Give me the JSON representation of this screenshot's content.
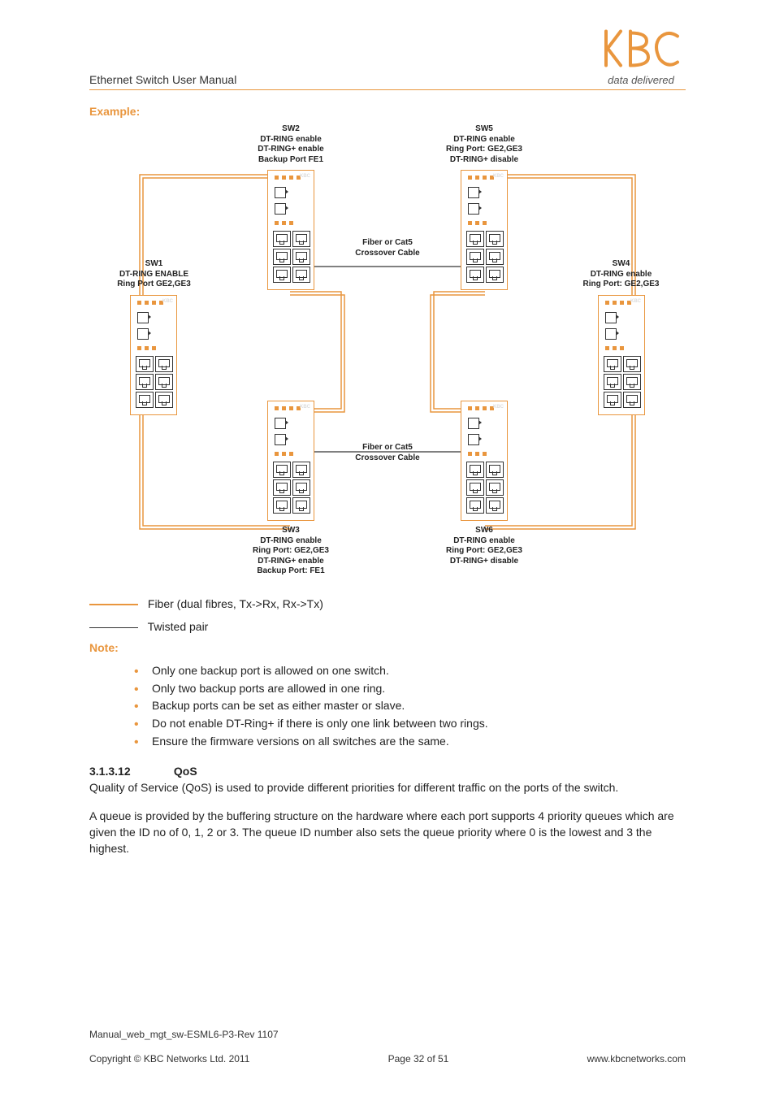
{
  "brand": {
    "tagline": "data delivered"
  },
  "header": {
    "title": "Ethernet Switch User Manual"
  },
  "example_heading": "Example:",
  "diagram": {
    "sw1": "SW1\nDT-RING ENABLE\nRing Port GE2,GE3",
    "sw2": "SW2\nDT-RING enable\nDT-RING+ enable\nBackup Port FE1",
    "sw3": "SW3\nDT-RING enable\nRing Port: GE2,GE3\nDT-RING+ enable\nBackup Port: FE1",
    "sw4": "SW4\nDT-RING enable\nRing Port: GE2,GE3",
    "sw5": "SW5\nDT-RING enable\nRing Port: GE2,GE3\nDT-RING+ disable",
    "sw6": "SW6\nDT-RING enable\nRing Port: GE2,GE3\nDT-RING+ disable",
    "cable_top": "Fiber or Cat5\nCrossover Cable",
    "cable_bottom": "Fiber or Cat5\nCrossover Cable"
  },
  "legend": {
    "fiber": "Fiber (dual fibres, Tx->Rx, Rx->Tx)",
    "twisted": "Twisted pair"
  },
  "note_heading": "Note:",
  "notes": [
    "Only one backup port is allowed on one switch.",
    "Only two backup ports are allowed in one ring.",
    "Backup ports can be set as either master or slave.",
    "Do not enable DT-Ring+ if there is only one link between two rings.",
    "Ensure the firmware versions on all switches are the same."
  ],
  "section": {
    "number": "3.1.3.12",
    "title": "QoS",
    "p1": "Quality of Service (QoS) is used to provide different priorities for different traffic on the ports of the switch.",
    "p2": "A queue is provided by the buffering structure on the hardware where each port supports 4 priority queues which are given the ID no of 0, 1, 2 or 3. The queue ID number also sets the queue priority where 0 is the lowest and 3 the highest."
  },
  "footer": {
    "filename": "Manual_web_mgt_sw-ESML6-P3-Rev 1107",
    "copyright": "Copyright © KBC Networks Ltd. 2011",
    "page": "Page 32 of 51",
    "url": "www.kbcnetworks.com"
  }
}
